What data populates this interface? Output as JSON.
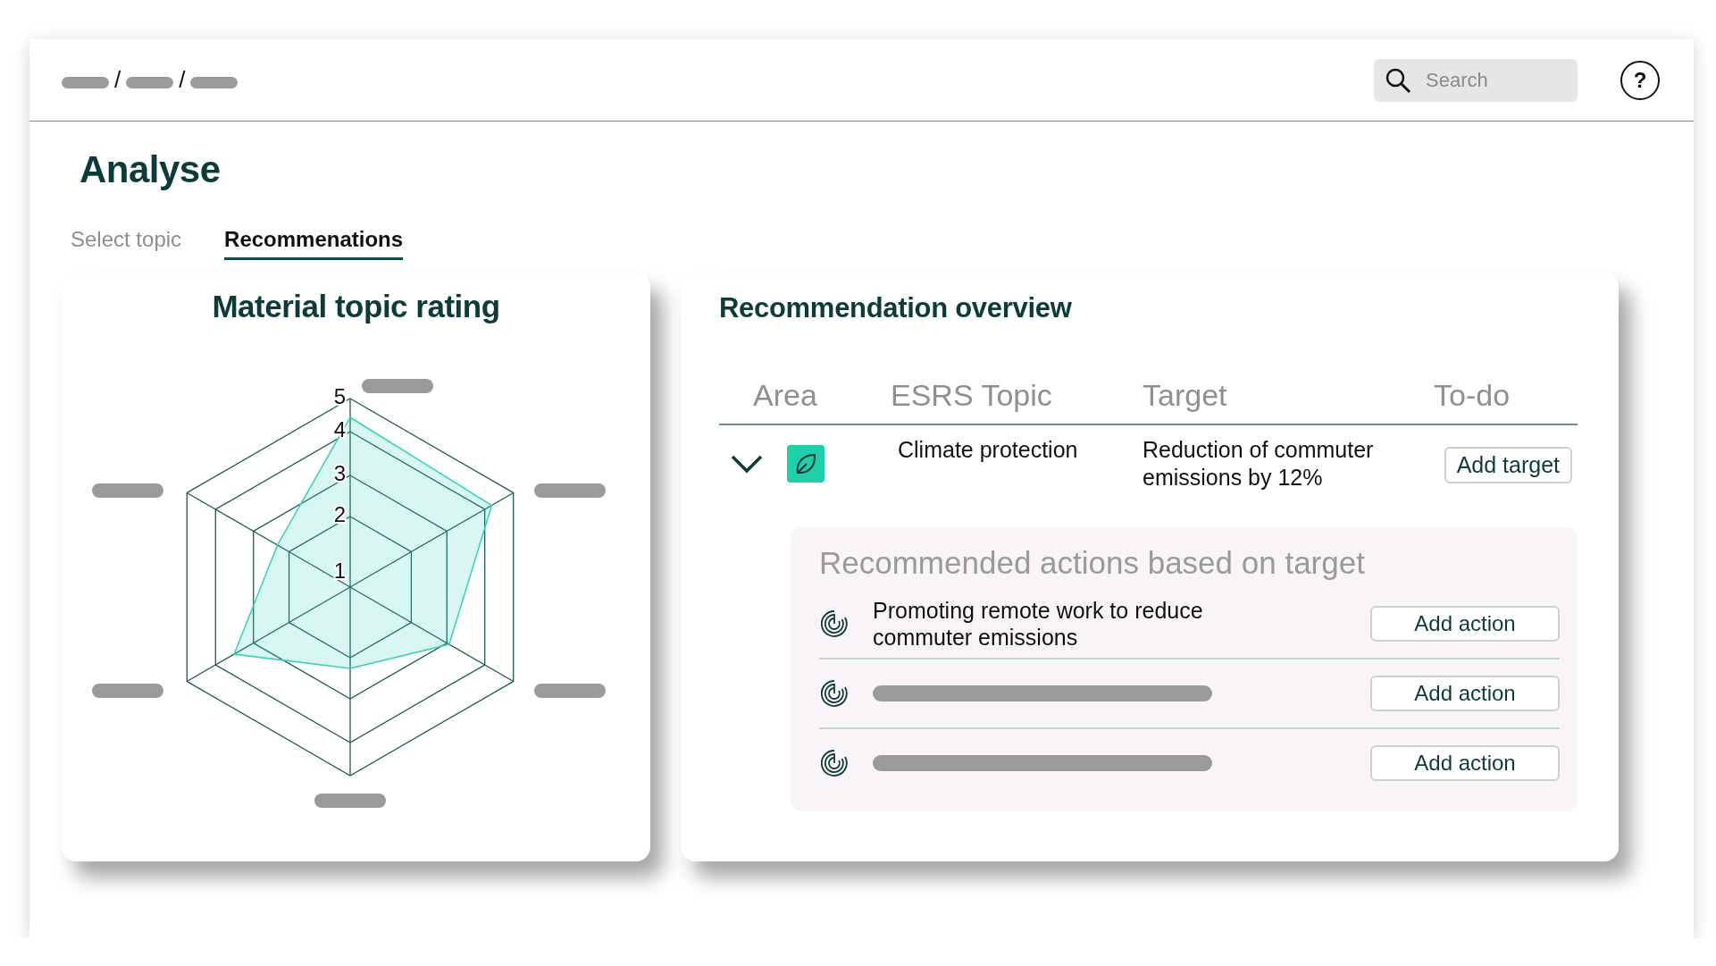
{
  "header": {
    "breadcrumb_separators": [
      "/",
      "/"
    ],
    "search": {
      "placeholder": "Search"
    },
    "help": "?"
  },
  "title": "Analyse",
  "tabs": [
    {
      "label": "Select topic",
      "selected": false
    },
    {
      "label": "Recommenations",
      "selected": true
    }
  ],
  "rating_card": {
    "title": "Material topic rating",
    "scale_labels": [
      "5",
      "4",
      "3",
      "2",
      "1"
    ]
  },
  "overview": {
    "title": "Recommendation overview",
    "columns": [
      "Area",
      "ESRS Topic",
      "Target",
      "To-do"
    ],
    "rows": [
      {
        "expanded": true,
        "topic": "Climate protection",
        "target": "Reduction of commuter emissions by 12%",
        "button": "Add target",
        "actions": {
          "heading": "Recommended actions based on target",
          "items": [
            {
              "kind": "text",
              "text": "Promoting remote work to reduce commuter emissions",
              "button": "Add action"
            },
            {
              "kind": "placeholder",
              "button": "Add action"
            },
            {
              "kind": "placeholder",
              "button": "Add action"
            }
          ]
        }
      }
    ]
  }
}
